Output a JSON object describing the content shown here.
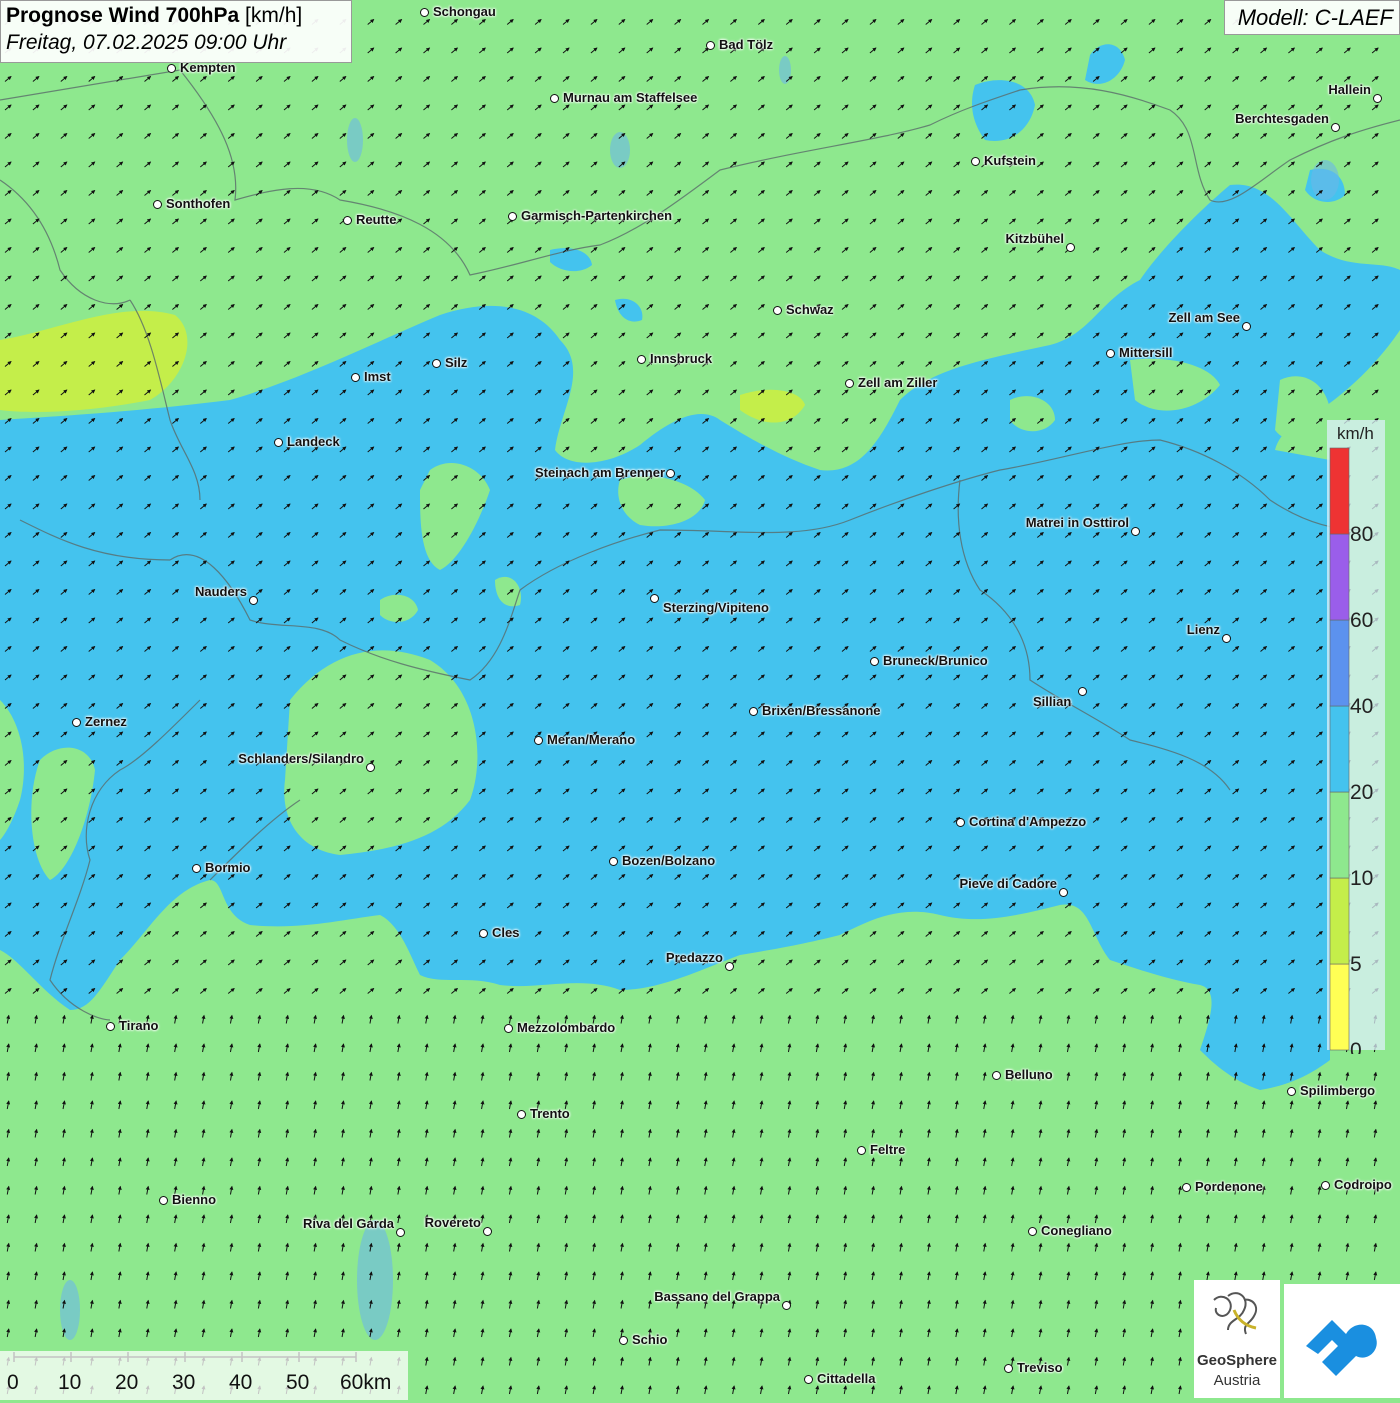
{
  "header": {
    "title_bold": "Prognose Wind 700hPa",
    "title_unit": "[km/h]",
    "datetime": "Freitag, 07.02.2025 09:00 Uhr",
    "model": "Modell: C-LAEF"
  },
  "legend": {
    "unit": "km/h",
    "stops": [
      {
        "value": "0",
        "color": "#ffff55"
      },
      {
        "value": "5",
        "color": "#c4ee4a"
      },
      {
        "value": "10",
        "color": "#8ee88e"
      },
      {
        "value": "20",
        "color": "#44c3ee"
      },
      {
        "value": "40",
        "color": "#5c92ee"
      },
      {
        "value": "60",
        "color": "#9a5eea"
      },
      {
        "value": "80",
        "color": "#ee3333"
      }
    ]
  },
  "scale_bar": {
    "labels": [
      "0",
      "10",
      "20",
      "30",
      "40",
      "50",
      "60km"
    ]
  },
  "cities": [
    {
      "name": "Schongau"
    },
    {
      "name": "Kempten"
    },
    {
      "name": "Bad Tölz"
    },
    {
      "name": "Murnau am Staffelsee"
    },
    {
      "name": "Hallein"
    },
    {
      "name": "Berchtesgaden"
    },
    {
      "name": "Kufstein"
    },
    {
      "name": "Sonthofen"
    },
    {
      "name": "Reutte"
    },
    {
      "name": "Garmisch-Partenkirchen"
    },
    {
      "name": "Kitzbühel"
    },
    {
      "name": "Schwaz"
    },
    {
      "name": "Zell am See"
    },
    {
      "name": "Mittersill"
    },
    {
      "name": "Imst"
    },
    {
      "name": "Silz"
    },
    {
      "name": "Innsbruck"
    },
    {
      "name": "Zell am Ziller"
    },
    {
      "name": "Landeck"
    },
    {
      "name": "Steinach am Brenner"
    },
    {
      "name": "Matrei in Osttirol"
    },
    {
      "name": "Nauders"
    },
    {
      "name": "Sterzing/Vipiteno"
    },
    {
      "name": "Lienz"
    },
    {
      "name": "Bruneck/Brunico"
    },
    {
      "name": "Sillian"
    },
    {
      "name": "Zernez"
    },
    {
      "name": "Brixen/Bressanone"
    },
    {
      "name": "Meran/Merano"
    },
    {
      "name": "Schlanders/Silandro"
    },
    {
      "name": "Cortina d'Ampezzo"
    },
    {
      "name": "Bozen/Bolzano"
    },
    {
      "name": "Bormio"
    },
    {
      "name": "Pieve di Cadore"
    },
    {
      "name": "Cles"
    },
    {
      "name": "Predazzo"
    },
    {
      "name": "Tirano"
    },
    {
      "name": "Mezzolombardo"
    },
    {
      "name": "Belluno"
    },
    {
      "name": "Spilimbergo"
    },
    {
      "name": "Trento"
    },
    {
      "name": "Feltre"
    },
    {
      "name": "Pordenone"
    },
    {
      "name": "Codroipo"
    },
    {
      "name": "Bienno"
    },
    {
      "name": "Riva del Garda"
    },
    {
      "name": "Rovereto"
    },
    {
      "name": "Conegliano"
    },
    {
      "name": "Bassano del Grappa"
    },
    {
      "name": "Schio"
    },
    {
      "name": "Treviso"
    },
    {
      "name": "Cittadella"
    }
  ],
  "logos": {
    "geosphere_line1": "GeoSphere",
    "geosphere_line2": "Austria"
  }
}
